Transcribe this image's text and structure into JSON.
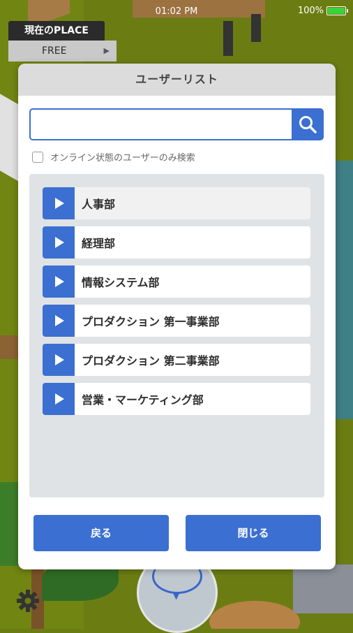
{
  "status_bar": {
    "time": "01:02 PM",
    "battery": "100%"
  },
  "place": {
    "label": "現在のPLACE",
    "value": "FREE"
  },
  "dialog": {
    "title": "ユーザーリスト",
    "search": {
      "value": "",
      "placeholder": ""
    },
    "online_only_label": "オンライン状態のユーザーのみ検索",
    "departments": [
      {
        "label": "人事部"
      },
      {
        "label": "経理部"
      },
      {
        "label": "情報システム部"
      },
      {
        "label": "プロダクション 第一事業部"
      },
      {
        "label": "プロダクション 第二事業部"
      },
      {
        "label": "営業・マーケティング部"
      }
    ],
    "back_label": "戻る",
    "close_label": "閉じる"
  },
  "colors": {
    "accent": "#3b6fd1",
    "header": "#dcdcdc",
    "panel": "#dfe3e6",
    "ground": "#6b7d12"
  }
}
